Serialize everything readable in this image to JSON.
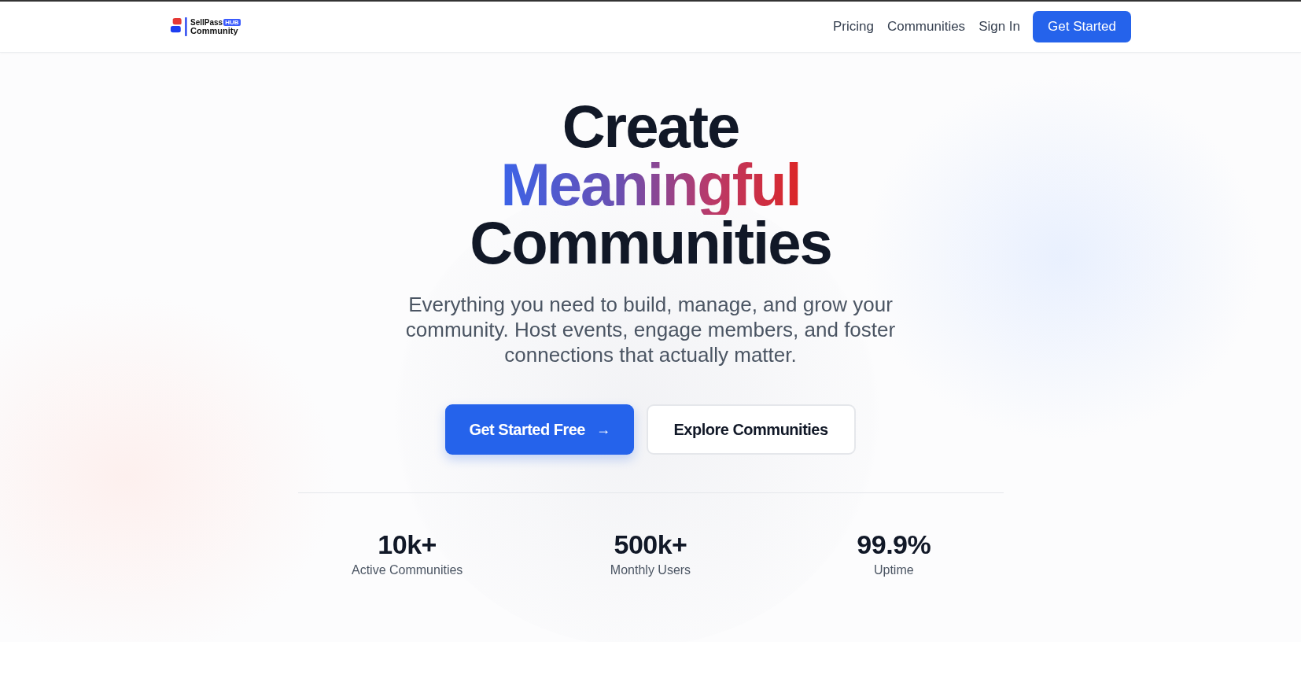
{
  "header": {
    "logo": {
      "name": "SellPass",
      "badge": "HUB",
      "subtitle": "Community"
    },
    "nav": [
      {
        "label": "Pricing",
        "kind": "link"
      },
      {
        "label": "Communities",
        "kind": "link"
      },
      {
        "label": "Sign In",
        "kind": "link"
      },
      {
        "label": "Get Started",
        "kind": "button"
      }
    ]
  },
  "hero": {
    "title_lines": [
      {
        "text": "Create",
        "kind": "plain"
      },
      {
        "text": "Meaningful",
        "kind": "gradient"
      },
      {
        "text": "Communities",
        "kind": "plain"
      }
    ],
    "subtitle": "Everything you need to build, manage, and grow your community. Host events, engage members, and foster connections that actually matter.",
    "buttons": [
      {
        "label": "Get Started Free",
        "kind": "primary",
        "arrow": "→"
      },
      {
        "label": "Explore Communities",
        "kind": "secondary"
      }
    ],
    "stats": [
      {
        "value": "10k+",
        "label": "Active Communities"
      },
      {
        "value": "500k+",
        "label": "Monthly Users"
      },
      {
        "value": "99.9%",
        "label": "Uptime"
      }
    ]
  }
}
